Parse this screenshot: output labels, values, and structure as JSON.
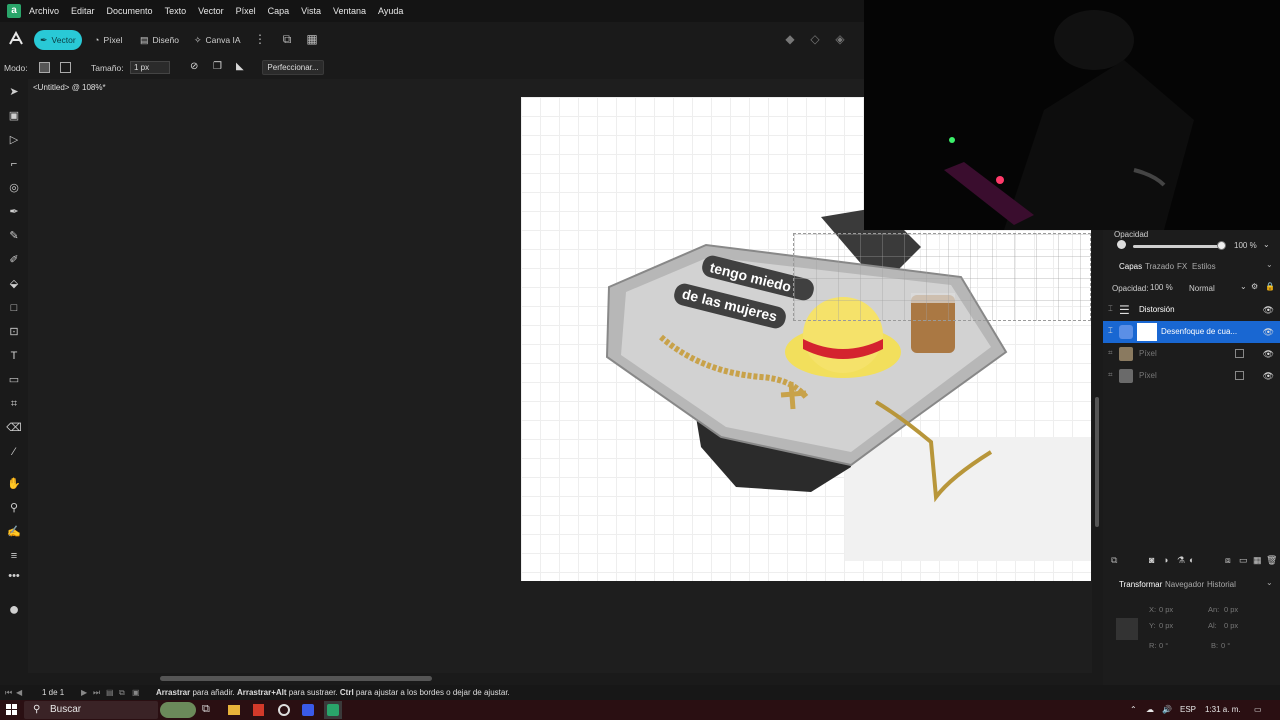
{
  "menubar": {
    "items": [
      "Archivo",
      "Editar",
      "Documento",
      "Texto",
      "Vector",
      "Píxel",
      "Capa",
      "Vista",
      "Ventana",
      "Ayuda"
    ]
  },
  "personas": [
    {
      "label": "Vector",
      "icon": "vector-persona-icon",
      "active": true
    },
    {
      "label": "Píxel",
      "icon": "pixel-persona-icon",
      "active": false
    },
    {
      "label": "Diseño",
      "icon": "layout-persona-icon",
      "active": false
    },
    {
      "label": "Canva IA",
      "icon": "ai-persona-icon",
      "active": false
    }
  ],
  "context_toolbar": {
    "mode_label": "Modo:",
    "size_label": "Tamaño:",
    "size_value": "1 px",
    "refine_label": "Perfeccionar..."
  },
  "document": {
    "tab_title": "<Untitled> @ 108%*"
  },
  "artwork": {
    "caption_line1": "tengo miedo",
    "caption_line2": "de las mujeres"
  },
  "panels": {
    "opacity_title": "Opacidad",
    "opacity_value": "100 %",
    "tabs": [
      "Capas",
      "Trazado",
      "FX",
      "Estilos"
    ],
    "layer_opacity_label": "Opacidad:",
    "layer_opacity_value": "100 %",
    "blend_mode": "Normal",
    "layers": [
      {
        "name": "Distorsión",
        "selected": false,
        "dim": false
      },
      {
        "name": "Desenfoque de cua...",
        "selected": true,
        "dim": false
      },
      {
        "name": "Píxel",
        "selected": false,
        "dim": true
      },
      {
        "name": "Píxel",
        "selected": false,
        "dim": true
      }
    ],
    "lower_tabs": [
      "Transformar",
      "Navegador",
      "Historial"
    ],
    "transform": {
      "x_label": "X:",
      "x_value": "0 px",
      "y_label": "Y:",
      "y_value": "0 px",
      "w_label": "An:",
      "w_value": "0 px",
      "h_label": "Al:",
      "h_value": "0 px",
      "r_label": "R:",
      "r_value": "0 °",
      "s_label": "B:",
      "s_value": "0 °"
    }
  },
  "status_bar": {
    "page": "1 de 1",
    "hint_bold1": "Arrastrar",
    "hint_text1": " para añadir. ",
    "hint_bold2": "Arrastrar+Alt",
    "hint_text2": " para sustraer. ",
    "hint_bold3": "Ctrl",
    "hint_text3": " para ajustar a los bordes o dejar de ajustar."
  },
  "taskbar": {
    "search_placeholder": "Buscar",
    "language": "ESP",
    "time": "1:31 a. m."
  },
  "colors": {
    "accent": "#29c9d6",
    "selection": "#1967d2",
    "taskbar": "#2a0f12"
  }
}
